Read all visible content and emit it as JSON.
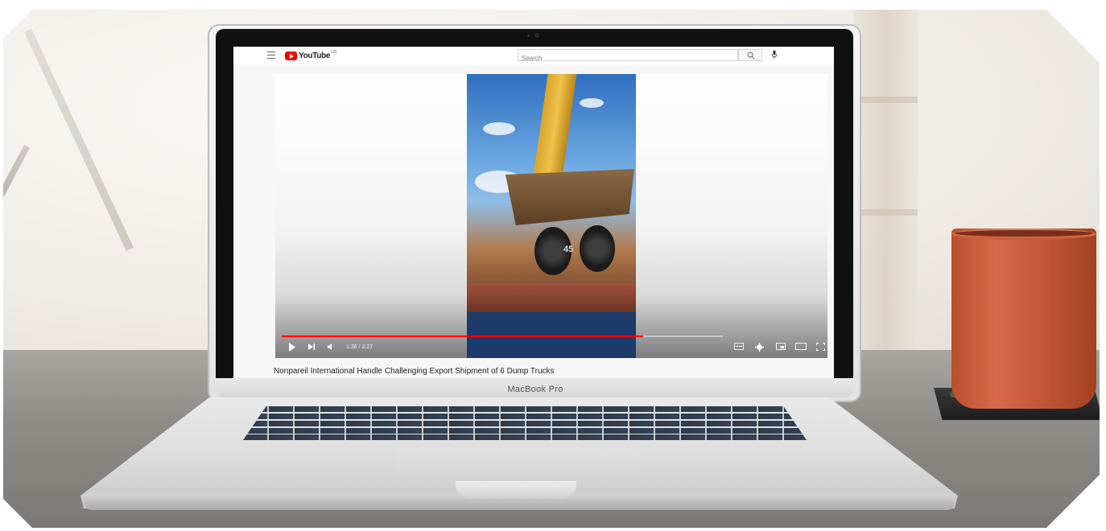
{
  "laptop": {
    "brand_label": "MacBook Pro"
  },
  "youtube": {
    "logo_text": "YouTube",
    "logo_country": "GB",
    "search": {
      "placeholder": "Search"
    },
    "player": {
      "time_display": "1:36 / 2:27",
      "progress_fraction": 0.82,
      "truck_number": "45"
    },
    "video_title": "Nonpareil International Handle Challenging Export Shipment of 6 Dump Trucks"
  },
  "icons": {
    "menu": "menu-icon",
    "search": "search-icon",
    "mic": "mic-icon",
    "play": "play-icon",
    "next": "next-icon",
    "volume": "volume-icon",
    "subtitles": "subtitles-icon",
    "settings": "gear-icon",
    "miniplayer": "miniplayer-icon",
    "theater": "theater-icon",
    "fullscreen": "fullscreen-icon"
  },
  "colors": {
    "youtube_red": "#ff0000",
    "mug": "#c65839"
  }
}
